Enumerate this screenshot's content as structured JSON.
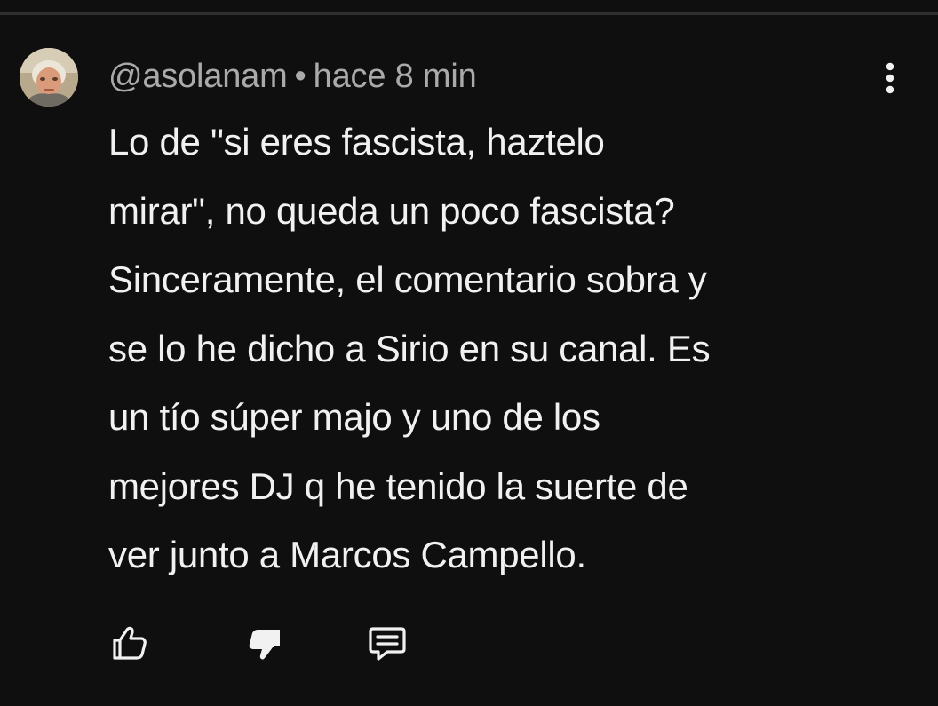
{
  "comment": {
    "author": "@asolanam",
    "separator": "•",
    "timestamp": "hace 8 min",
    "text": "Lo de \"si eres fascista, haztelo\nmirar\", no queda un poco fascista?\nSinceramente, el comentario sobra y\nse lo he dicho a Sirio en su canal. Es\nun tío súper majo y uno de los\nmejores DJ q he tenido la suerte de\nver junto a Marcos Campello."
  },
  "icons": {
    "avatar": "user-avatar",
    "more": "more-vert-icon",
    "like": "thumb-up-icon",
    "dislike": "thumb-down-icon",
    "reply": "comment-reply-icon"
  },
  "colors": {
    "background": "#0f0f0f",
    "primary_text": "#f1f1f1",
    "secondary_text": "#aaaaaa",
    "divider": "#2e2e2e"
  }
}
